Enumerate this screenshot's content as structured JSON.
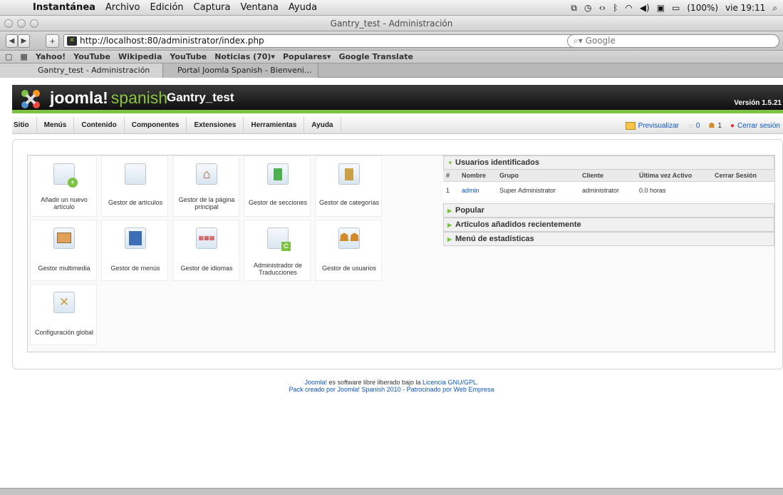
{
  "mac_menu": {
    "app": "Instantánea",
    "items": [
      "Archivo",
      "Edición",
      "Captura",
      "Ventana",
      "Ayuda"
    ],
    "battery": "(100%)",
    "clock": "vie 19:11"
  },
  "window": {
    "title": "Gantry_test - Administración"
  },
  "browser": {
    "url": "http://localhost:80/administrator/index.php",
    "search_placeholder": "Google",
    "bookmarks": [
      "Yahoo!",
      "YouTube",
      "Wikipedia",
      "YouTube",
      "Noticias (70)▾",
      "Populares▾",
      "Google Translate"
    ],
    "tabs": [
      {
        "label": "Gantry_test - Administración"
      },
      {
        "label": "Portal Joomla Spanish - Bienveni..."
      }
    ]
  },
  "joomla": {
    "brand": "joomla!",
    "brand_sub": "spanish",
    "site_name": "Gantry_test",
    "version": "Versión 1.5.21",
    "menu": [
      "Sitio",
      "Menús",
      "Contenido",
      "Componentes",
      "Extensiones",
      "Herramientas",
      "Ayuda"
    ],
    "preview": "Previsualizar",
    "messages_count": "0",
    "users_count": "1",
    "logout": "Cerrar sesión"
  },
  "icons": [
    {
      "label": "Añadir un nuevo artículo",
      "icon": "add-article-icon"
    },
    {
      "label": "Gestor de artículos",
      "icon": "article-manager-icon"
    },
    {
      "label": "Gestor de la página principal",
      "icon": "frontpage-icon"
    },
    {
      "label": "Gestor de secciones",
      "icon": "section-icon"
    },
    {
      "label": "Gestor de categorías",
      "icon": "category-icon"
    },
    {
      "label": "Gestor multimedia",
      "icon": "media-icon"
    },
    {
      "label": "Gestor de menús",
      "icon": "menu-icon"
    },
    {
      "label": "Gestor de idiomas",
      "icon": "language-icon"
    },
    {
      "label": "Administrador de Traducciones",
      "icon": "translation-icon"
    },
    {
      "label": "Gestor de usuarios",
      "icon": "users-icon"
    },
    {
      "label": "Configuración global",
      "icon": "config-icon"
    }
  ],
  "panel": {
    "logged_users_title": "Usuarios identificados",
    "headers": [
      "#",
      "Nombre",
      "Grupo",
      "Cliente",
      "Última vez Activo",
      "Cerrar Sesión"
    ],
    "rows": [
      [
        "1",
        "admin",
        "Super Administrator",
        "administrator",
        "0.0 horas",
        ""
      ]
    ],
    "collapsed": [
      "Popular",
      "Artículos añadidos recientemente",
      "Menú de estadísticas"
    ]
  },
  "footer": {
    "line1_a": "Joomla!",
    "line1_b": " es software libre liberado bajo la ",
    "line1_c": "Licencia GNU/GPL.",
    "line2_a": "Pack creado por Joomla! Spanish 2010 - Patrocinado por ",
    "line2_b": "Web Empresa"
  },
  "colors": {
    "accent": "#7dc242",
    "link": "#0b55c4",
    "header_bg": "#1a1a1a"
  }
}
